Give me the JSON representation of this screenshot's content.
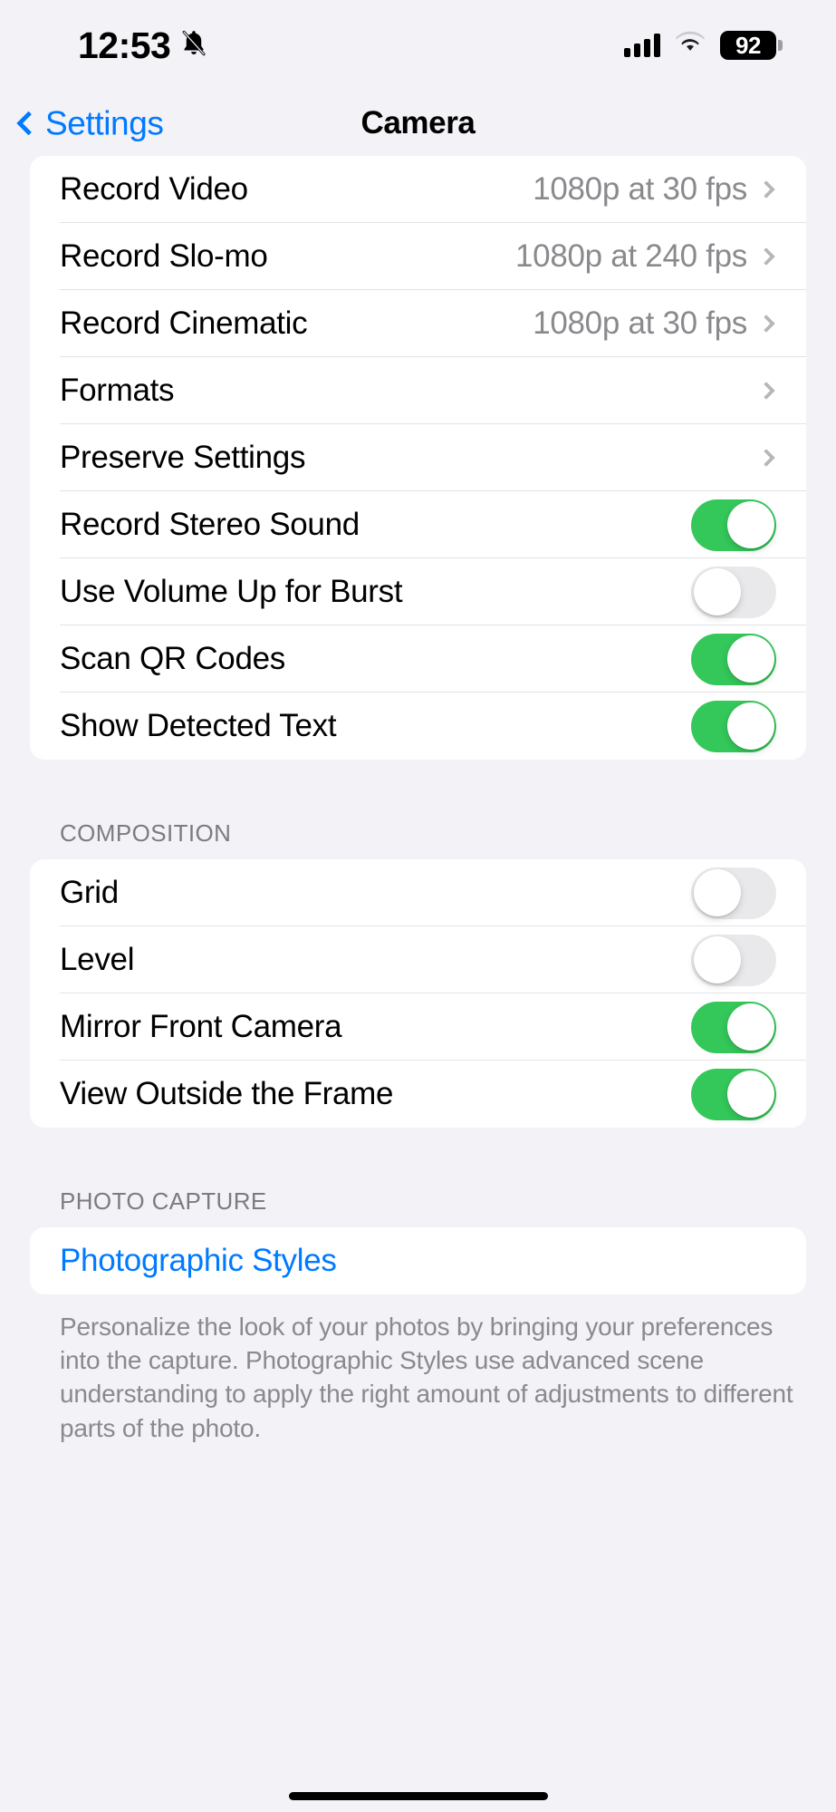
{
  "status_bar": {
    "time": "12:53",
    "silent_icon": "bell-slash-icon",
    "signal_icon": "cellular-signal-icon",
    "signal_bars": 4,
    "wifi_icon": "wifi-icon",
    "battery_level": "92"
  },
  "nav": {
    "back_label": "Settings",
    "title": "Camera"
  },
  "sections": [
    {
      "header": "",
      "rows": [
        {
          "label": "Record Video",
          "value": "1080p at 30 fps",
          "type": "disclosure"
        },
        {
          "label": "Record Slo-mo",
          "value": "1080p at 240 fps",
          "type": "disclosure"
        },
        {
          "label": "Record Cinematic",
          "value": "1080p at 30 fps",
          "type": "disclosure"
        },
        {
          "label": "Formats",
          "value": "",
          "type": "disclosure"
        },
        {
          "label": "Preserve Settings",
          "value": "",
          "type": "disclosure"
        },
        {
          "label": "Record Stereo Sound",
          "value": "",
          "type": "toggle",
          "on": true
        },
        {
          "label": "Use Volume Up for Burst",
          "value": "",
          "type": "toggle",
          "on": false
        },
        {
          "label": "Scan QR Codes",
          "value": "",
          "type": "toggle",
          "on": true
        },
        {
          "label": "Show Detected Text",
          "value": "",
          "type": "toggle",
          "on": true
        }
      ],
      "footer": ""
    },
    {
      "header": "COMPOSITION",
      "rows": [
        {
          "label": "Grid",
          "value": "",
          "type": "toggle",
          "on": false
        },
        {
          "label": "Level",
          "value": "",
          "type": "toggle",
          "on": false
        },
        {
          "label": "Mirror Front Camera",
          "value": "",
          "type": "toggle",
          "on": true
        },
        {
          "label": "View Outside the Frame",
          "value": "",
          "type": "toggle",
          "on": true
        }
      ],
      "footer": ""
    },
    {
      "header": "PHOTO CAPTURE",
      "rows": [
        {
          "label": "Photographic Styles",
          "value": "",
          "type": "link"
        }
      ],
      "footer": "Personalize the look of your photos by bringing your preferences into the capture. Photographic Styles use advanced scene understanding to apply the right amount of adjustments to different parts of the photo."
    }
  ],
  "colors": {
    "accent_blue": "#007AFF",
    "toggle_on_green": "#34C759",
    "toggle_off_gray": "#E9E9EB",
    "page_background": "#F2F2F7",
    "card_background": "#FFFFFF",
    "secondary_text": "#8A8A8E"
  },
  "home_indicator": "home-indicator"
}
